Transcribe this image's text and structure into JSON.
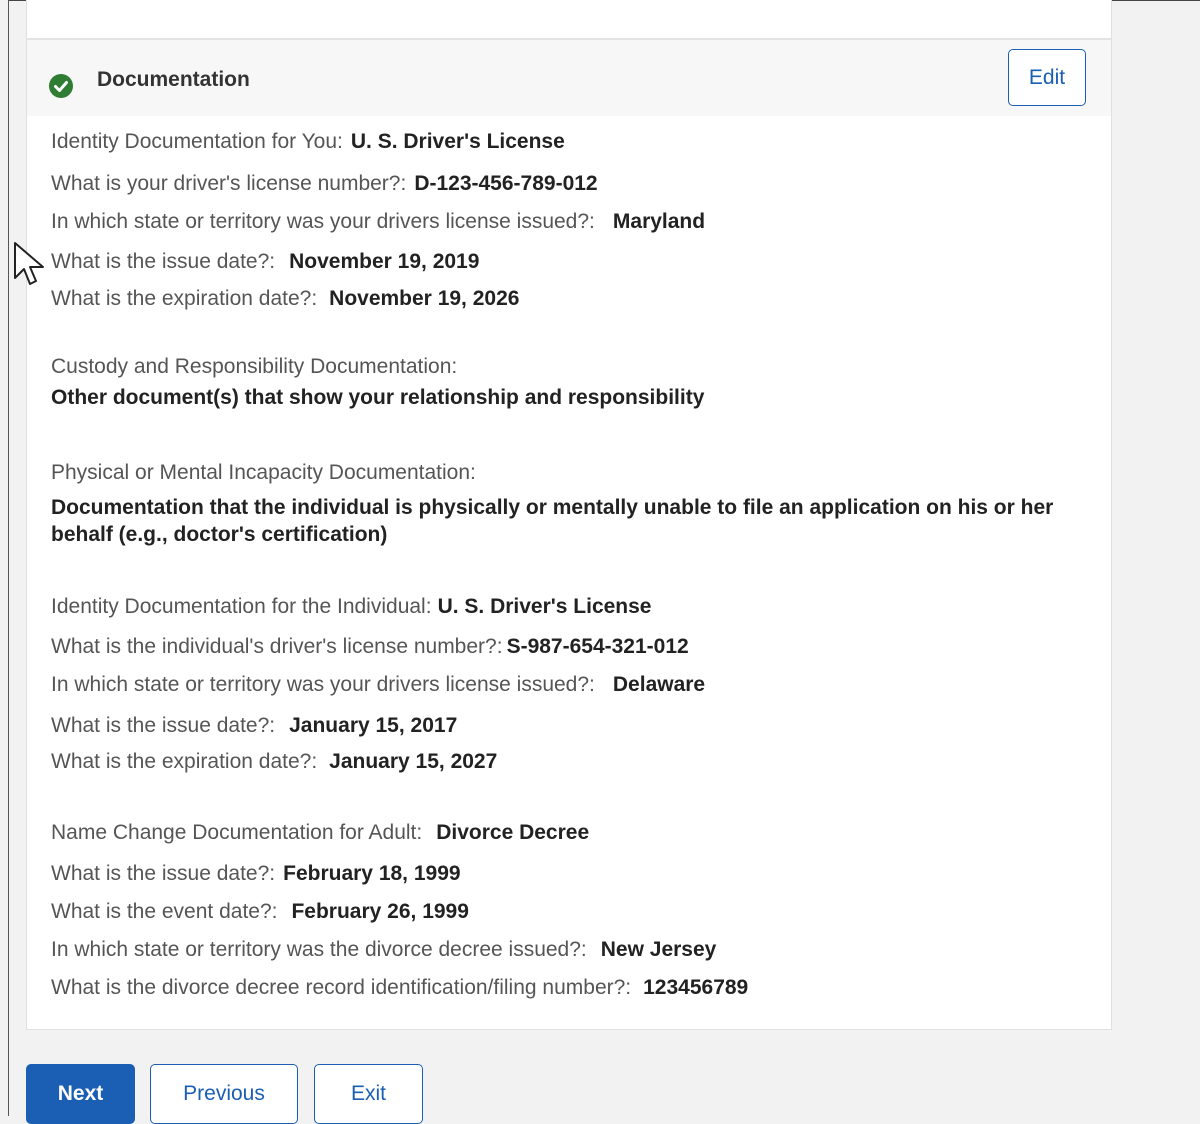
{
  "section": {
    "title": "Documentation",
    "edit_label": "Edit"
  },
  "identity_you": {
    "q1": "Identity Documentation for You:",
    "a1": "U. S. Driver's License",
    "q2": "What is your driver's license number?:",
    "a2": "D-123-456-789-012",
    "q3": "In which state or territory was your drivers license issued?:",
    "a3": "Maryland",
    "q4": "What is the issue date?:",
    "a4": "November 19, 2019",
    "q5": "What is the expiration date?:",
    "a5": "November 19, 2026"
  },
  "custody": {
    "label": "Custody and Responsibility Documentation:",
    "value": "Other document(s) that show your relationship and responsibility"
  },
  "incapacity": {
    "label": "Physical or Mental Incapacity Documentation:",
    "value": "Documentation that the individual is physically or mentally unable to file an application on his or her behalf (e.g., doctor's certification)"
  },
  "identity_individual": {
    "q1": "Identity Documentation for the Individual:",
    "a1": "U. S. Driver's License",
    "q2": "What is the individual's driver's license number?:",
    "a2": "S-987-654-321-012",
    "q3": "In which state or territory was your drivers license issued?:",
    "a3": "Delaware",
    "q4": "What is the issue date?:",
    "a4": "January 15, 2017",
    "q5": "What is the expiration date?:",
    "a5": "January 15, 2027"
  },
  "name_change": {
    "q1": "Name Change Documentation for Adult:",
    "a1": "Divorce Decree",
    "q2": "What is the issue date?:",
    "a2": "February 18, 1999",
    "q3": "What is the event date?:",
    "a3": "February 26, 1999",
    "q4": "In which state or territory was the divorce decree issued?:",
    "a4": "New Jersey",
    "q5": "What is the divorce decree record identification/filing number?:",
    "a5": "123456789"
  },
  "nav": {
    "next_label": "Next",
    "previous_label": "Previous",
    "exit_label": "Exit"
  },
  "colors": {
    "accent": "#1a5fb4",
    "success": "#2e7d32"
  },
  "icons": {
    "status": "check-circle-icon",
    "pointer": "mouse-pointer-icon"
  }
}
